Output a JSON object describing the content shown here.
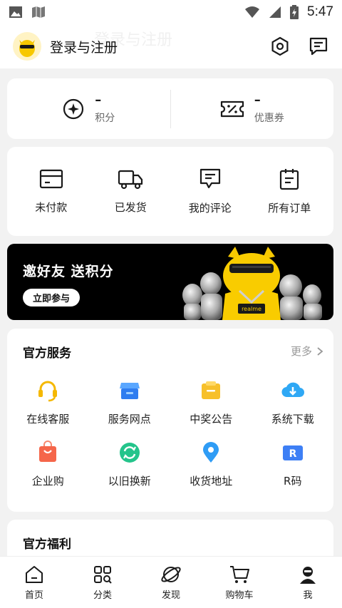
{
  "status_bar": {
    "time": "5:47"
  },
  "header": {
    "login_text": "登录与注册",
    "ghost_text": "登录与注册"
  },
  "points": [
    {
      "icon": "points-icon",
      "value": "–",
      "label": "积分"
    },
    {
      "icon": "coupon-icon",
      "value": "–",
      "label": "优惠券"
    }
  ],
  "orders": [
    {
      "icon": "wallet-icon",
      "label": "未付款"
    },
    {
      "icon": "truck-icon",
      "label": "已发货"
    },
    {
      "icon": "comment-icon",
      "label": "我的评论"
    },
    {
      "icon": "clipboard-icon",
      "label": "所有订单"
    }
  ],
  "banner": {
    "title": "邀好友 送积分",
    "button_label": "立即参与",
    "brand_tag": "realme"
  },
  "services": {
    "title": "官方服务",
    "more_label": "更多",
    "items": [
      {
        "icon": "headset-icon",
        "label": "在线客服",
        "color": "#f5b800"
      },
      {
        "icon": "store-icon",
        "label": "服务网点",
        "color": "#3a8ef6"
      },
      {
        "icon": "notice-icon",
        "label": "中奖公告",
        "color": "#f7c02a"
      },
      {
        "icon": "cloud-download-icon",
        "label": "系统下载",
        "color": "#2fa8f5"
      },
      {
        "icon": "shopping-bag-icon",
        "label": "企业购",
        "color": "#f5664a"
      },
      {
        "icon": "refresh-icon",
        "label": "以旧换新",
        "color": "#24c48b"
      },
      {
        "icon": "location-pin-icon",
        "label": "收货地址",
        "color": "#2f9cf5"
      },
      {
        "icon": "r-code-icon",
        "label": "R码",
        "color": "#3d7ff5"
      }
    ]
  },
  "welfare": {
    "title": "官方福利"
  },
  "nav": [
    {
      "icon": "home-icon",
      "label": "首页"
    },
    {
      "icon": "category-icon",
      "label": "分类"
    },
    {
      "icon": "discover-icon",
      "label": "发现"
    },
    {
      "icon": "cart-icon",
      "label": "购物车"
    },
    {
      "icon": "profile-icon",
      "label": "我"
    }
  ]
}
